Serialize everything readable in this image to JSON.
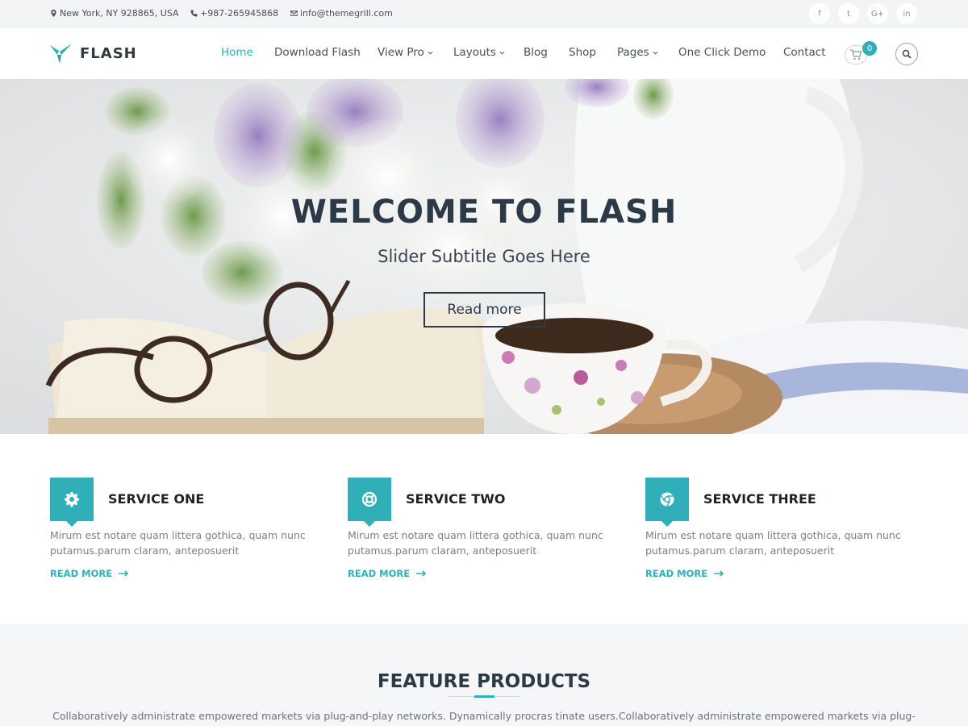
{
  "topbar": {
    "address": "New York, NY 928865, USA",
    "phone": "+987-265945868",
    "email": "info@themegrill.com",
    "social": [
      "f",
      "t",
      "G+",
      "in"
    ]
  },
  "header": {
    "logo": "FLASH",
    "nav": [
      "Home",
      "Download Flash",
      "View Pro",
      "Layouts",
      "Blog",
      "Shop",
      "Pages",
      "One Click Demo",
      "Contact"
    ],
    "nav_active": "Home",
    "nav_with_dropdown": [
      "View Pro",
      "Layouts",
      "Pages"
    ],
    "cart_count": "0"
  },
  "hero": {
    "title": "WELCOME TO FLASH",
    "subtitle": "Slider Subtitle Goes Here",
    "button": "Read more"
  },
  "services": [
    {
      "title": "SERVICE ONE",
      "icon": "gear-icon",
      "text": "Mirum est notare quam littera gothica, quam nunc putamus.parum claram, anteposuerit",
      "link": "READ MORE"
    },
    {
      "title": "SERVICE TWO",
      "icon": "life-ring-icon",
      "text": "Mirum est notare quam littera gothica, quam nunc putamus.parum claram, anteposuerit",
      "link": "READ MORE"
    },
    {
      "title": "SERVICE THREE",
      "icon": "chrome-icon",
      "text": "Mirum est notare quam littera gothica, quam nunc putamus.parum claram, anteposuerit",
      "link": "READ MORE"
    }
  ],
  "features": {
    "title": "FEATURE PRODUCTS",
    "text": "Collaboratively administrate empowered markets via plug-and-play networks. Dynamically procras tinate users.Collaboratively administrate empowered markets via plug-"
  },
  "colors": {
    "accent": "#30afb8",
    "dark": "#2c3a47",
    "topbar_bg": "#f2f4f6"
  }
}
